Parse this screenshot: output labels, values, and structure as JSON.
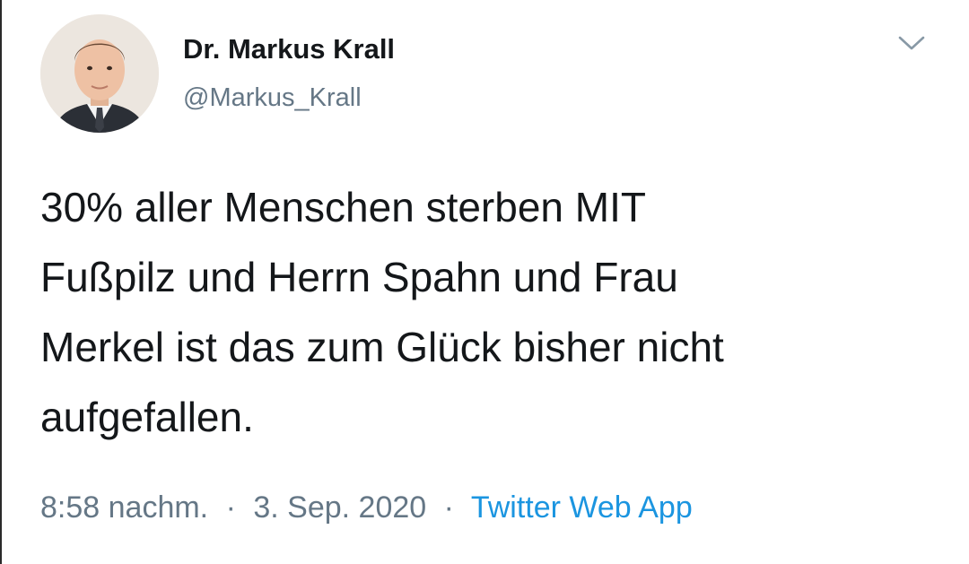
{
  "author": {
    "display_name": "Dr. Markus Krall",
    "handle": "@Markus_Krall"
  },
  "tweet": {
    "text_lines": [
      "30% aller Menschen sterben MIT",
      "Fußpilz und Herrn Spahn und Frau",
      "Merkel ist das zum Glück bisher nicht",
      "aufgefallen."
    ]
  },
  "meta": {
    "time": "8:58 nachm.",
    "separator": "·",
    "date": "3. Sep. 2020",
    "source": "Twitter Web App"
  },
  "icons": {
    "menu": "chevron-down-icon",
    "avatar": "profile-photo"
  },
  "colors": {
    "text": "#14171a",
    "secondary_text": "#657786",
    "link": "#1b95e0",
    "chevron": "#8899a6"
  }
}
